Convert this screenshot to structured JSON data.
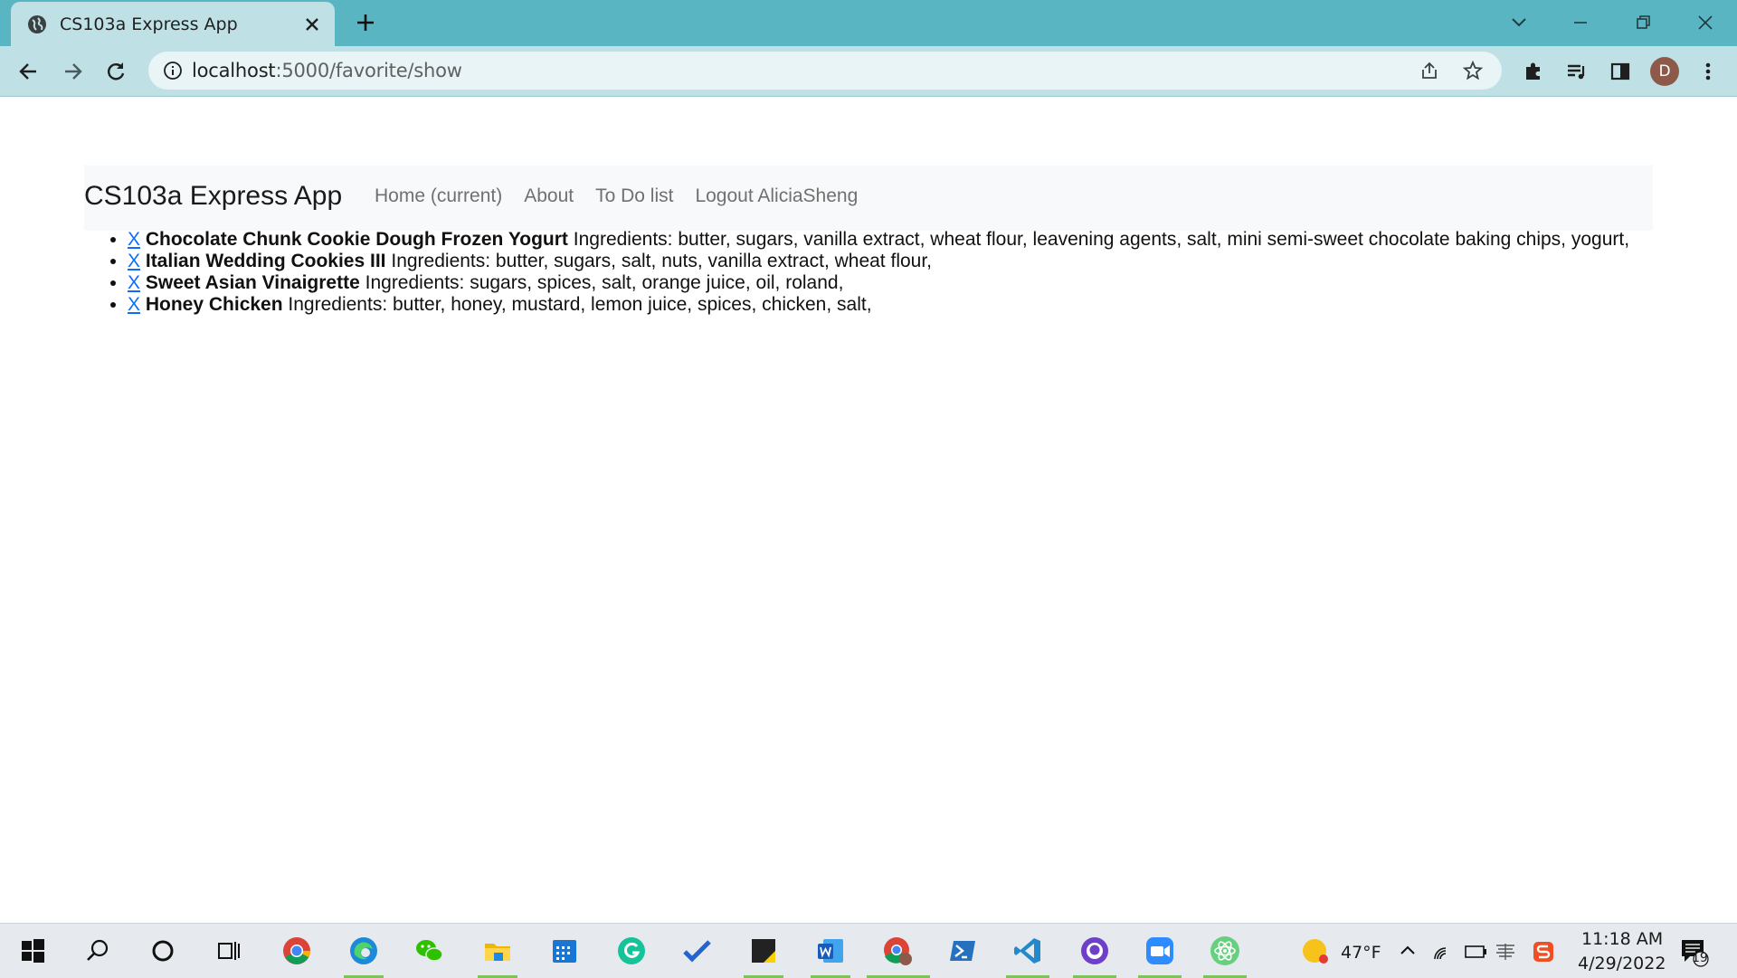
{
  "browser": {
    "tab_title": "CS103a Express App",
    "url_host": "localhost",
    "url_path": ":5000/favorite/show",
    "profile_initial": "D"
  },
  "navbar": {
    "brand": "CS103a Express App",
    "links": [
      "Home (current)",
      "About",
      "To Do list",
      "Logout AliciaSheng"
    ]
  },
  "favorites": [
    {
      "delete": "X",
      "name": "Chocolate Chunk Cookie Dough Frozen Yogurt",
      "ingredients": "Ingredients: butter, sugars, vanilla extract, wheat flour, leavening agents, salt, mini semi-sweet chocolate baking chips, yogurt,"
    },
    {
      "delete": "X",
      "name": "Italian Wedding Cookies III",
      "ingredients": "Ingredients: butter, sugars, salt, nuts, vanilla extract, wheat flour,"
    },
    {
      "delete": "X",
      "name": "Sweet Asian Vinaigrette",
      "ingredients": "Ingredients: sugars, spices, salt, orange juice, oil, roland,"
    },
    {
      "delete": "X",
      "name": "Honey Chicken",
      "ingredients": "Ingredients: butter, honey, mustard, lemon juice, spices, chicken, salt,"
    }
  ],
  "taskbar": {
    "weather": "47°F",
    "time": "11:18 AM",
    "date": "4/29/2022",
    "notifications": "19"
  },
  "colors": {
    "tabstrip": "#5ab5c3",
    "toolbar": "#bfe1e6",
    "link": "#0d6efd",
    "navbar_bg": "#f8f9fa"
  }
}
